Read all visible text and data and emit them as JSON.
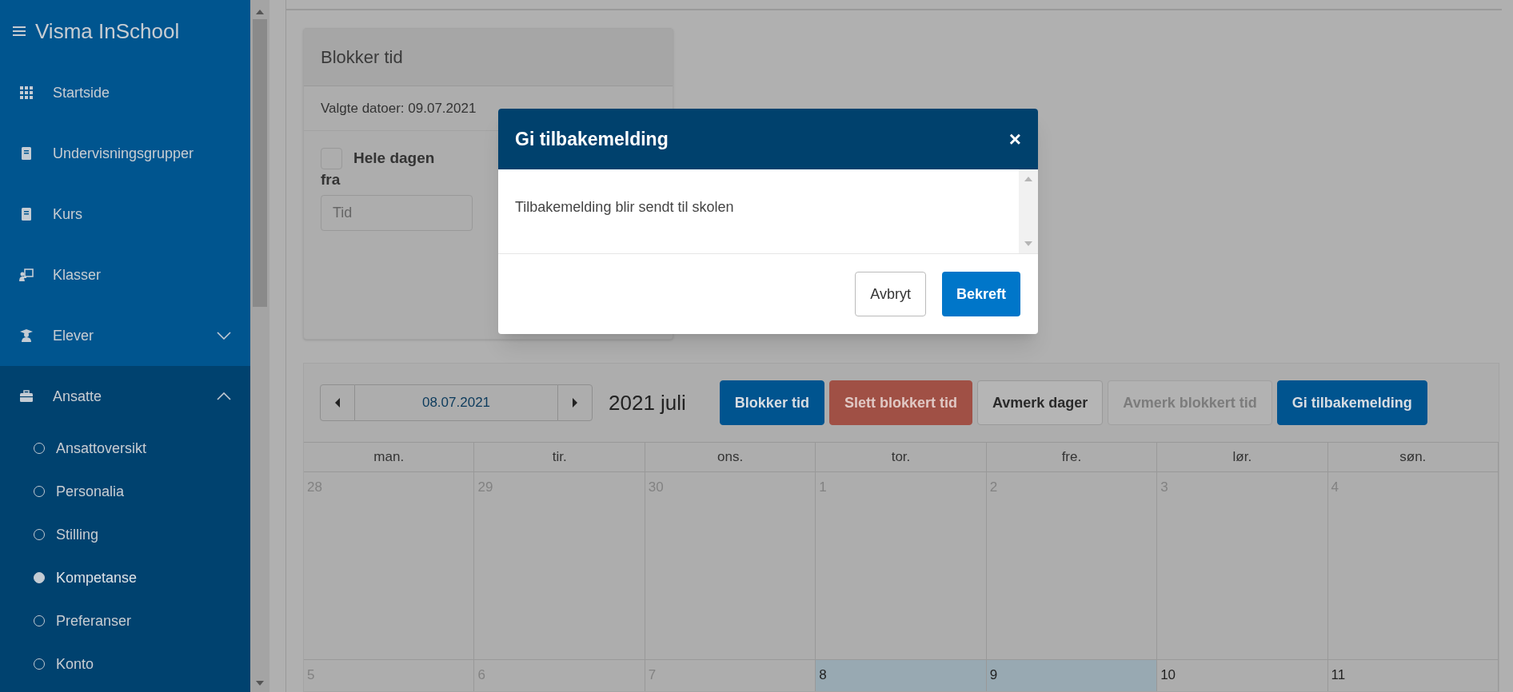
{
  "sidebar": {
    "title": "Visma InSchool",
    "items": [
      {
        "label": "Startside",
        "kind": "link"
      },
      {
        "label": "Undervisningsgrupper",
        "kind": "link"
      },
      {
        "label": "Kurs",
        "kind": "link"
      },
      {
        "label": "Klasser",
        "kind": "link"
      },
      {
        "label": "Elever",
        "kind": "group",
        "expanded": false
      },
      {
        "label": "Ansatte",
        "kind": "group",
        "expanded": true,
        "children": [
          {
            "label": "Ansattoversikt",
            "selected": false
          },
          {
            "label": "Personalia",
            "selected": false
          },
          {
            "label": "Stilling",
            "selected": false
          },
          {
            "label": "Kompetanse",
            "selected": true
          },
          {
            "label": "Preferanser",
            "selected": false
          },
          {
            "label": "Konto",
            "selected": false
          }
        ]
      }
    ]
  },
  "block_panel": {
    "title": "Blokker tid",
    "selected_dates": "Valgte datoer: 09.07.2021",
    "all_day": {
      "label": "Hele dagen",
      "checked": false
    },
    "from_label": "fra",
    "time_field": {
      "placeholder": "Tid"
    }
  },
  "calendar": {
    "date_field": {
      "value": "08.07.2021"
    },
    "month_title": "2021 juli",
    "buttons": [
      {
        "label": "Blokker tid",
        "kind": "primary"
      },
      {
        "label": "Slett blokkert tid",
        "kind": "danger"
      },
      {
        "label": "Avmerk dager",
        "kind": "default"
      },
      {
        "label": "Avmerk blokkert tid",
        "kind": "disabled"
      },
      {
        "label": "Gi tilbakemelding",
        "kind": "primary"
      }
    ],
    "weekdays": [
      "man.",
      "tir.",
      "ons.",
      "tor.",
      "fre.",
      "lør.",
      "søn."
    ],
    "weeks": [
      [
        {
          "day": "28",
          "dimmed": true,
          "selected": false
        },
        {
          "day": "29",
          "dimmed": true,
          "selected": false
        },
        {
          "day": "30",
          "dimmed": true,
          "selected": false
        },
        {
          "day": "1",
          "dimmed": true,
          "selected": false
        },
        {
          "day": "2",
          "dimmed": true,
          "selected": false
        },
        {
          "day": "3",
          "dimmed": true,
          "selected": false
        },
        {
          "day": "4",
          "dimmed": true,
          "selected": false
        }
      ],
      [
        {
          "day": "5",
          "dimmed": true,
          "selected": false
        },
        {
          "day": "6",
          "dimmed": true,
          "selected": false
        },
        {
          "day": "7",
          "dimmed": true,
          "selected": false
        },
        {
          "day": "8",
          "dimmed": false,
          "selected": true
        },
        {
          "day": "9",
          "dimmed": false,
          "selected": true
        },
        {
          "day": "10",
          "dimmed": false,
          "selected": false
        },
        {
          "day": "11",
          "dimmed": false,
          "selected": false
        }
      ]
    ]
  },
  "dialog": {
    "title": "Gi tilbakemelding",
    "close": "×",
    "message": "Tilbakemelding blir sendt til skolen",
    "buttons": [
      {
        "label": "Avbryt",
        "kind": "secondary"
      },
      {
        "label": "Bekreft",
        "kind": "primary"
      }
    ]
  }
}
